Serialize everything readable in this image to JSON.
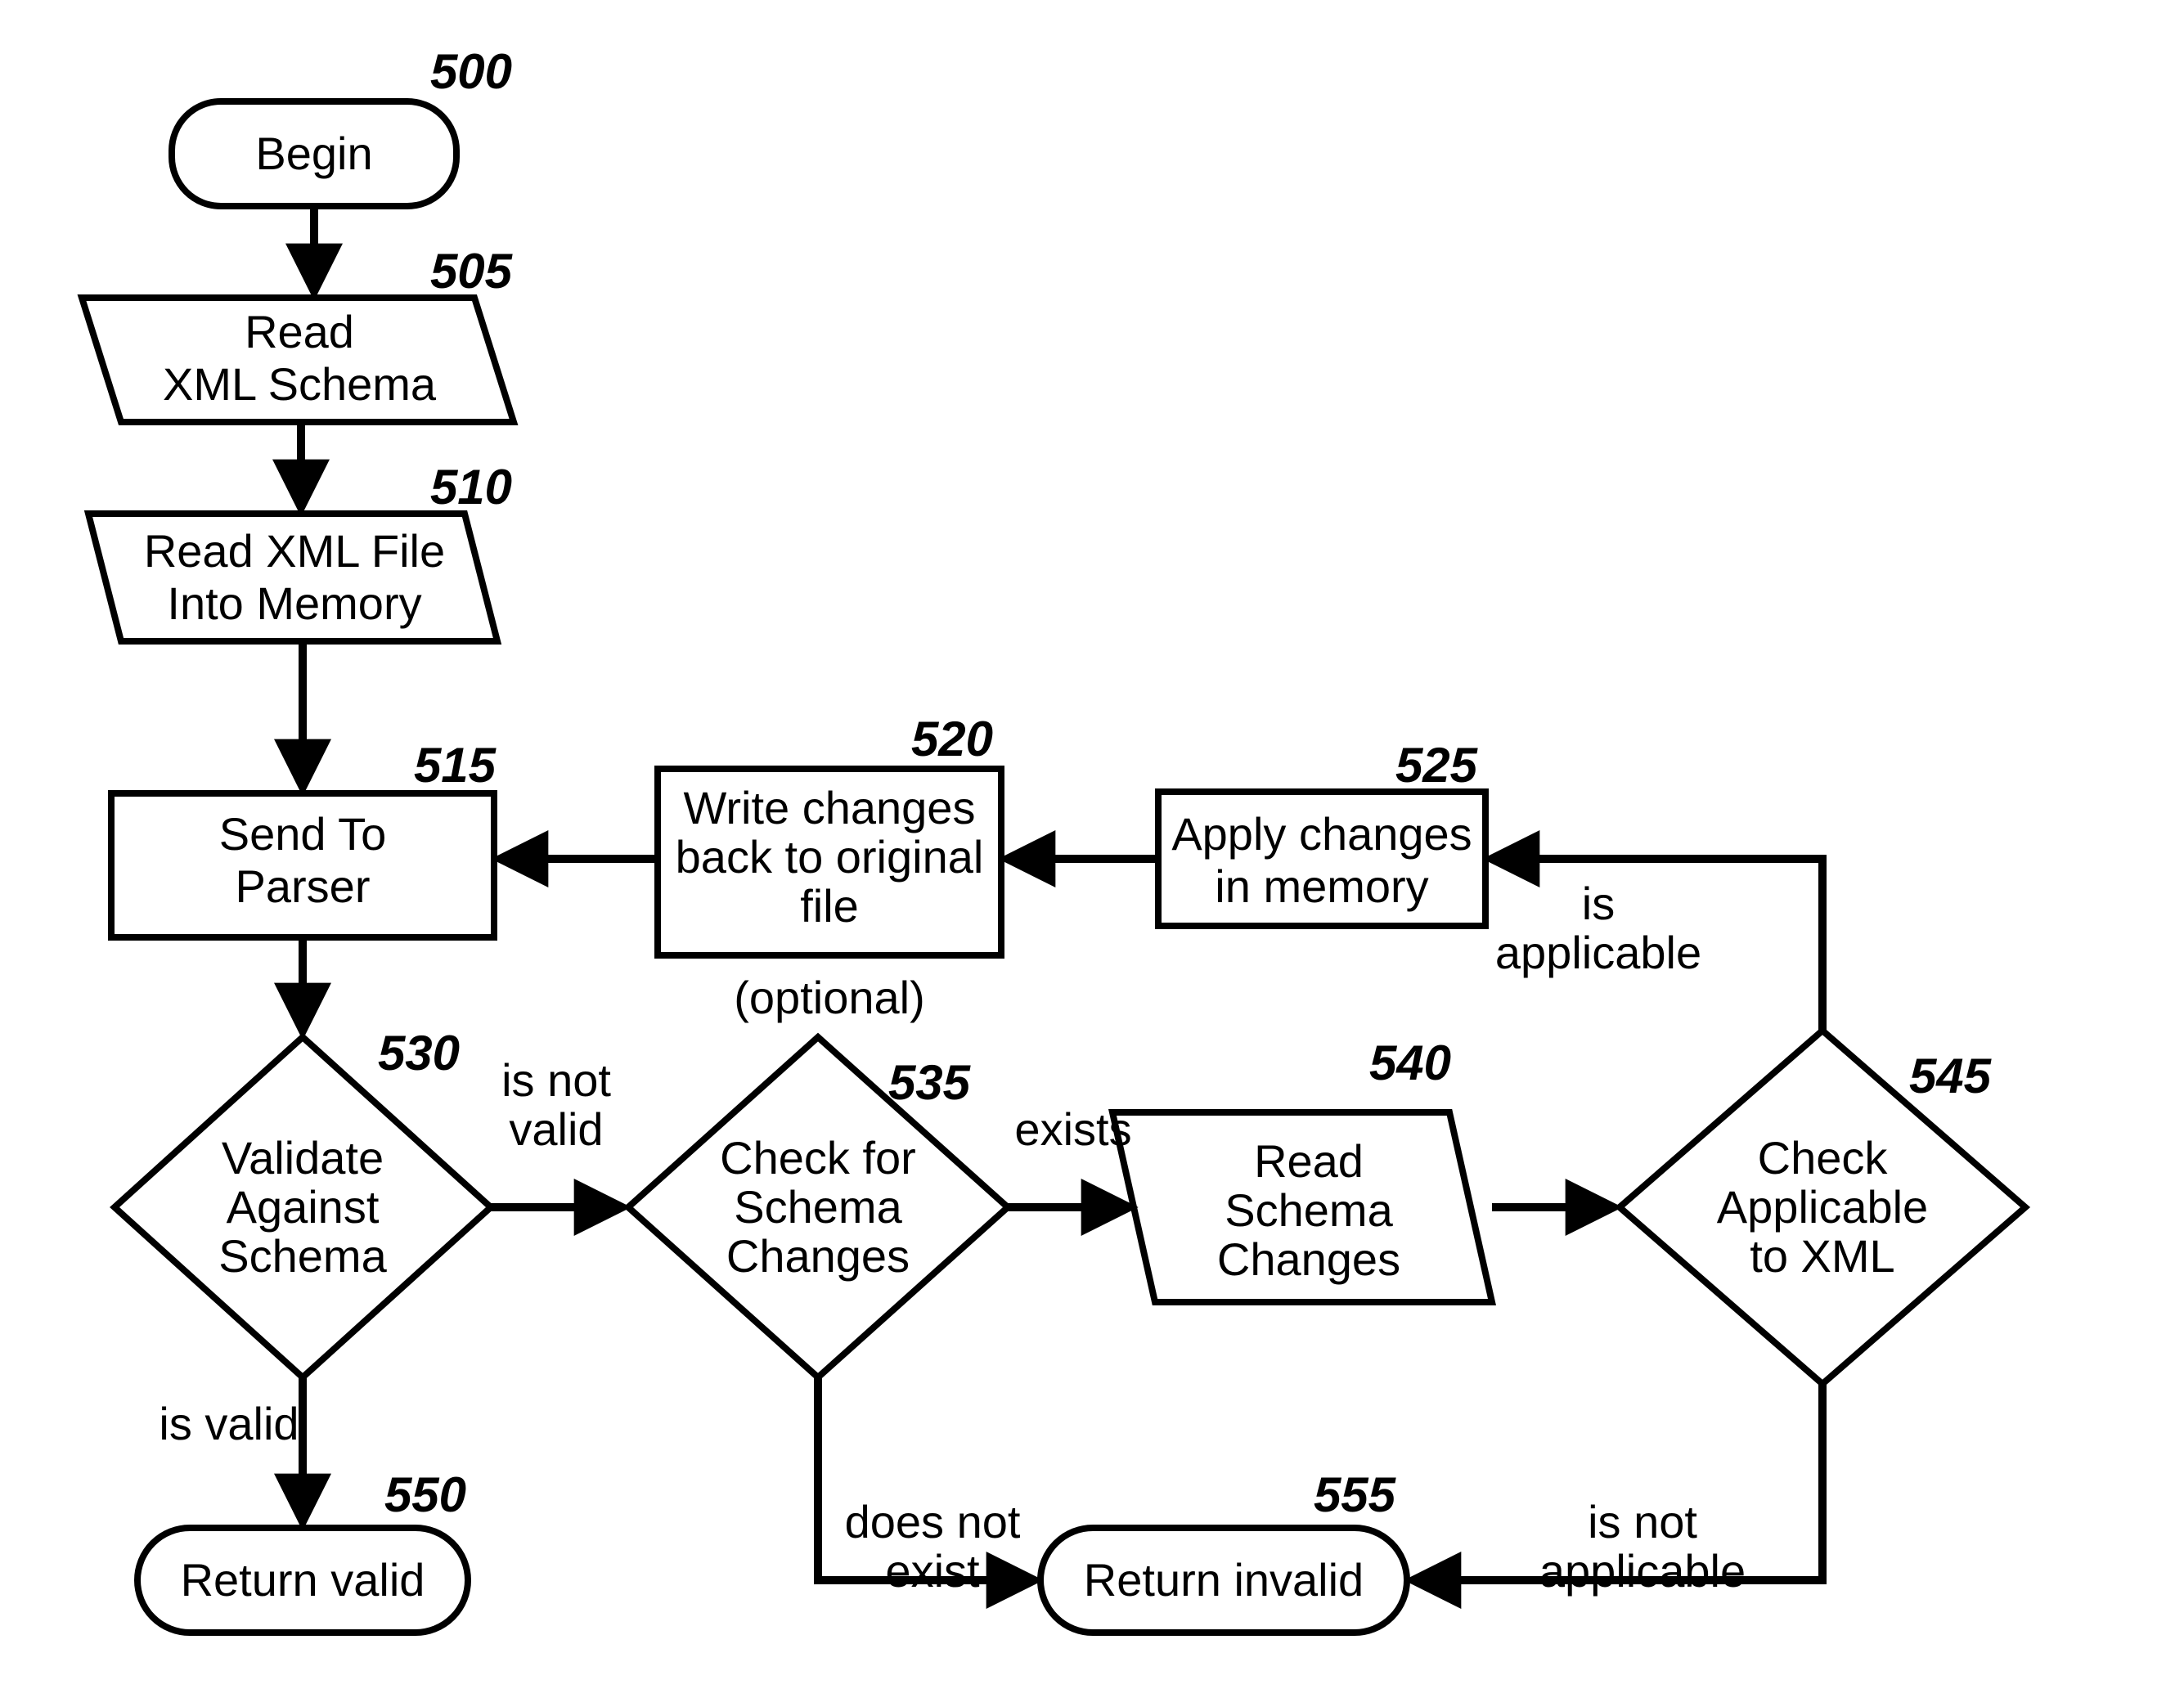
{
  "chart_data": {
    "type": "flowchart",
    "nodes": [
      {
        "id": "500",
        "ref": "500",
        "shape": "terminator",
        "text": "Begin"
      },
      {
        "id": "505",
        "ref": "505",
        "shape": "io",
        "text": "Read\nXML Schema"
      },
      {
        "id": "510",
        "ref": "510",
        "shape": "io",
        "text": "Read XML File\nInto Memory"
      },
      {
        "id": "515",
        "ref": "515",
        "shape": "process",
        "text": "Send To\nParser"
      },
      {
        "id": "520",
        "ref": "520",
        "shape": "process",
        "text": "Write changes\nback to original\nfile",
        "subtext": "(optional)"
      },
      {
        "id": "525",
        "ref": "525",
        "shape": "process",
        "text": "Apply changes\nin memory"
      },
      {
        "id": "530",
        "ref": "530",
        "shape": "decision",
        "text": "Validate\nAgainst\nSchema"
      },
      {
        "id": "535",
        "ref": "535",
        "shape": "decision",
        "text": "Check for\nSchema\nChanges"
      },
      {
        "id": "540",
        "ref": "540",
        "shape": "io",
        "text": "Read\nSchema\nChanges"
      },
      {
        "id": "545",
        "ref": "545",
        "shape": "decision",
        "text": "Check\nApplicable\nto XML"
      },
      {
        "id": "550",
        "ref": "550",
        "shape": "terminator",
        "text": "Return valid"
      },
      {
        "id": "555",
        "ref": "555",
        "shape": "terminator",
        "text": "Return invalid"
      }
    ],
    "edges": [
      {
        "from": "500",
        "to": "505"
      },
      {
        "from": "505",
        "to": "510"
      },
      {
        "from": "510",
        "to": "515"
      },
      {
        "from": "515",
        "to": "530"
      },
      {
        "from": "530",
        "to": "550",
        "label": "is valid"
      },
      {
        "from": "530",
        "to": "535",
        "label": "is not\nvalid"
      },
      {
        "from": "535",
        "to": "540",
        "label": "exists"
      },
      {
        "from": "535",
        "to": "555",
        "label": "does not\nexist"
      },
      {
        "from": "540",
        "to": "545"
      },
      {
        "from": "545",
        "to": "525",
        "label": "is\napplicable"
      },
      {
        "from": "545",
        "to": "555",
        "label": "is not\napplicable"
      },
      {
        "from": "525",
        "to": "520"
      },
      {
        "from": "520",
        "to": "515"
      }
    ]
  },
  "refs": {
    "n500": "500",
    "n505": "505",
    "n510": "510",
    "n515": "515",
    "n520": "520",
    "n525": "525",
    "n530": "530",
    "n535": "535",
    "n540": "540",
    "n545": "545",
    "n550": "550",
    "n555": "555"
  },
  "labels": {
    "begin": "Begin",
    "read_line1": "Read",
    "read_line2": "XML Schema",
    "readfile_line1": "Read XML File",
    "readfile_line2": "Into Memory",
    "send_line1": "Send To",
    "send_line2": "Parser",
    "write_line1": "Write changes",
    "write_line2": "back to original",
    "write_line3": "file",
    "write_sub": "(optional)",
    "apply_line1": "Apply changes",
    "apply_line2": "in memory",
    "validate_line1": "Validate",
    "validate_line2": "Against",
    "validate_line3": "Schema",
    "checksc_line1": "Check for",
    "checksc_line2": "Schema",
    "checksc_line3": "Changes",
    "readsc_line1": "Read",
    "readsc_line2": "Schema",
    "readsc_line3": "Changes",
    "checkapp_line1": "Check",
    "checkapp_line2": "Applicable",
    "checkapp_line3": "to XML",
    "ret_valid": "Return valid",
    "ret_invalid": "Return invalid"
  },
  "edge_labels": {
    "is_valid": "is valid",
    "is_not1": "is not",
    "is_not2": "valid",
    "exists": "exists",
    "dne1": "does not",
    "dne2": "exist",
    "is_app1": "is",
    "is_app2": "applicable",
    "is_napp1": "is not",
    "is_napp2": "applicable"
  }
}
